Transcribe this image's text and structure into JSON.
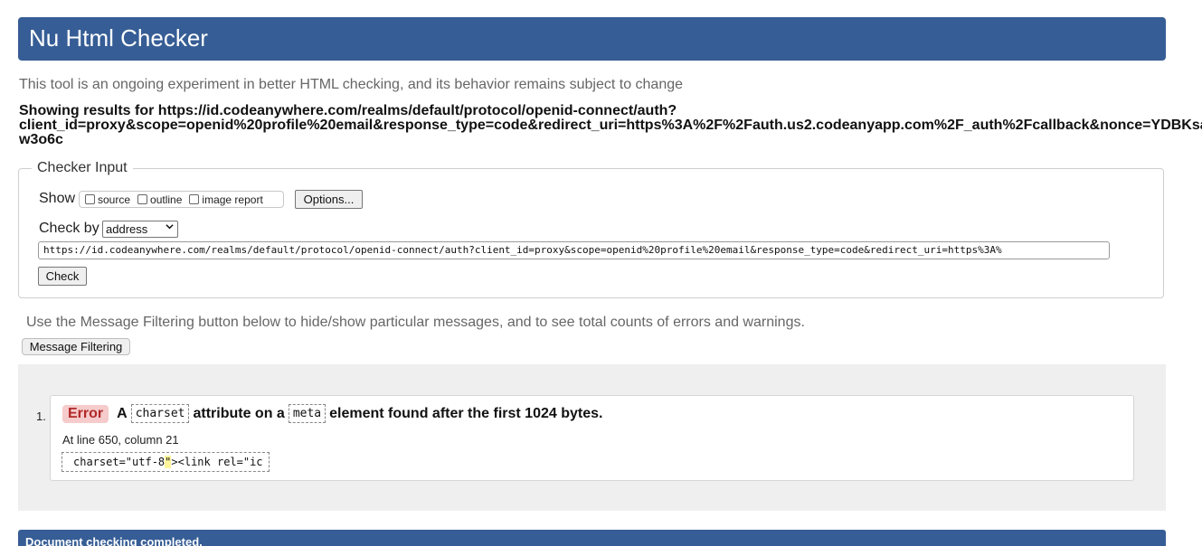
{
  "header": {
    "title": "Nu Html Checker"
  },
  "tagline": "This tool is an ongoing experiment in better HTML checking, and its behavior remains subject to change",
  "results_heading": {
    "line1": "Showing results for https://id.codeanywhere.com/realms/default/protocol/openid-connect/auth?",
    "line2": "client_id=proxy&scope=openid%20profile%20email&response_type=code&redirect_uri=https%3A%2F%2Fauth.us2.codeanyapp.com%2F_auth%2Fcallback&nonce=YDBKsa",
    "line3": "w3o6c"
  },
  "checker_input": {
    "legend": "Checker Input",
    "show_label": "Show",
    "options": [
      {
        "label": "source",
        "checked": false
      },
      {
        "label": "outline",
        "checked": false
      },
      {
        "label": "image report",
        "checked": false
      }
    ],
    "options_button": "Options...",
    "check_by_label": "Check by",
    "check_by_value": "address",
    "url_value": "https://id.codeanywhere.com/realms/default/protocol/openid-connect/auth?client_id=proxy&scope=openid%20profile%20email&response_type=code&redirect_uri=https%3A%",
    "check_button": "Check"
  },
  "filter_note": "Use the Message Filtering button below to hide/show particular messages, and to see total counts of errors and warnings.",
  "filter_button": "Message Filtering",
  "messages": [
    {
      "number": "1.",
      "type": "Error",
      "text_a": "A",
      "code1": "charset",
      "text_b": "attribute on a",
      "code2": "meta",
      "text_c": "element found after the first 1024 bytes.",
      "location": "At line 650, column 21",
      "extract_before": "charset=\"utf-8",
      "extract_highlight": "\"",
      "extract_after": "><link rel=\"ic"
    }
  ],
  "footer": {
    "status": "Document checking completed."
  },
  "colors": {
    "banner": "#365d95",
    "error_badge_bg": "#f6cbcb",
    "error_badge_text": "#b02a2a",
    "panel_bg": "#efefef"
  }
}
